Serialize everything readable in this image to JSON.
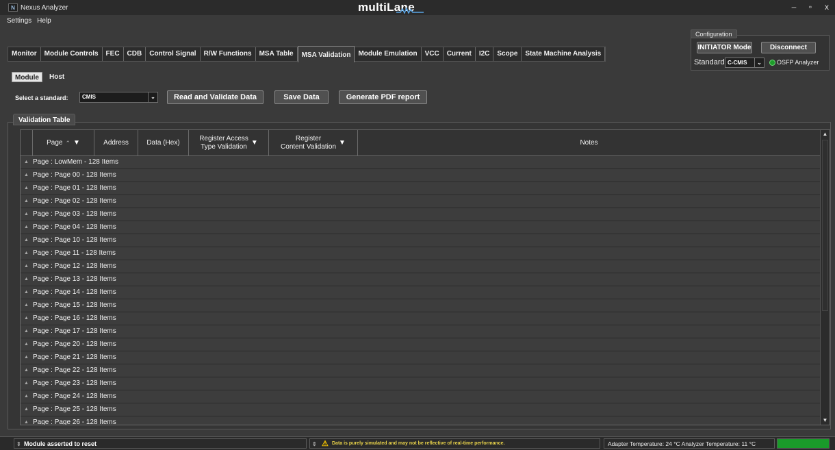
{
  "window": {
    "app_title": "Nexus Analyzer",
    "brand": "multiLane",
    "minimize": "–",
    "restore": "▫",
    "close": "x"
  },
  "menu": [
    "Settings",
    "Help"
  ],
  "tabs": [
    {
      "label": "Monitor",
      "active": false
    },
    {
      "label": "Module Controls",
      "active": false
    },
    {
      "label": "FEC",
      "active": false
    },
    {
      "label": "CDB",
      "active": false
    },
    {
      "label": "Control Signal",
      "active": false
    },
    {
      "label": "R/W Functions",
      "active": false
    },
    {
      "label": "MSA Table",
      "active": false
    },
    {
      "label": "MSA Validation",
      "active": true
    },
    {
      "label": "Module Emulation",
      "active": false
    },
    {
      "label": "VCC",
      "active": false
    },
    {
      "label": "Current",
      "active": false
    },
    {
      "label": "I2C",
      "active": false
    },
    {
      "label": "Scope",
      "active": false
    },
    {
      "label": "State Machine Analysis",
      "active": false
    }
  ],
  "configuration": {
    "title": "Configuration",
    "mode_button": "INITIATOR Mode",
    "disconnect_button": "Disconnect",
    "standard_label": "Standard",
    "standard_value": "C-CMIS",
    "analyzer_label": "OSFP Analyzer",
    "led_color": "#1e9b2a"
  },
  "side_toggle": {
    "module": "Module",
    "host": "Host",
    "selected": "Module"
  },
  "toolbar": {
    "select_label": "Select a standard:",
    "select_value": "CMIS",
    "read_validate": "Read and Validate Data",
    "save": "Save Data",
    "pdf": "Generate PDF report"
  },
  "validation_table": {
    "title": "Validation Table",
    "columns": {
      "page": "Page",
      "address": "Address",
      "data_hex": "Data (Hex)",
      "access_l1": "Register Access",
      "access_l2": "Type Validation",
      "content_l1": "Register",
      "content_l2": "Content Validation",
      "notes": "Notes"
    },
    "groups": [
      "Page : LowMem - 128 Items",
      "Page : Page 00 - 128 Items",
      "Page : Page 01 - 128 Items",
      "Page : Page 02 - 128 Items",
      "Page : Page 03 - 128 Items",
      "Page : Page 04 - 128 Items",
      "Page : Page 10 - 128 Items",
      "Page : Page 11 - 128 Items",
      "Page : Page 12 - 128 Items",
      "Page : Page 13 - 128 Items",
      "Page : Page 14 - 128 Items",
      "Page : Page 15 - 128 Items",
      "Page : Page 16 - 128 Items",
      "Page : Page 17 - 128 Items",
      "Page : Page 20 - 128 Items",
      "Page : Page 21 - 128 Items",
      "Page : Page 22 - 128 Items",
      "Page : Page 23 - 128 Items",
      "Page : Page 24 - 128 Items",
      "Page : Page 25 - 128 Items",
      "Page : Page 26 - 128 Items"
    ]
  },
  "status": {
    "left": "Module asserted to reset",
    "middle": "Data is purely simulated and may not be reflective of real-time performance.",
    "right": "Adapter Temperature: 24 °C  Analyzer Temperature: 11 °C",
    "indicator_color": "#1a9a2a"
  }
}
